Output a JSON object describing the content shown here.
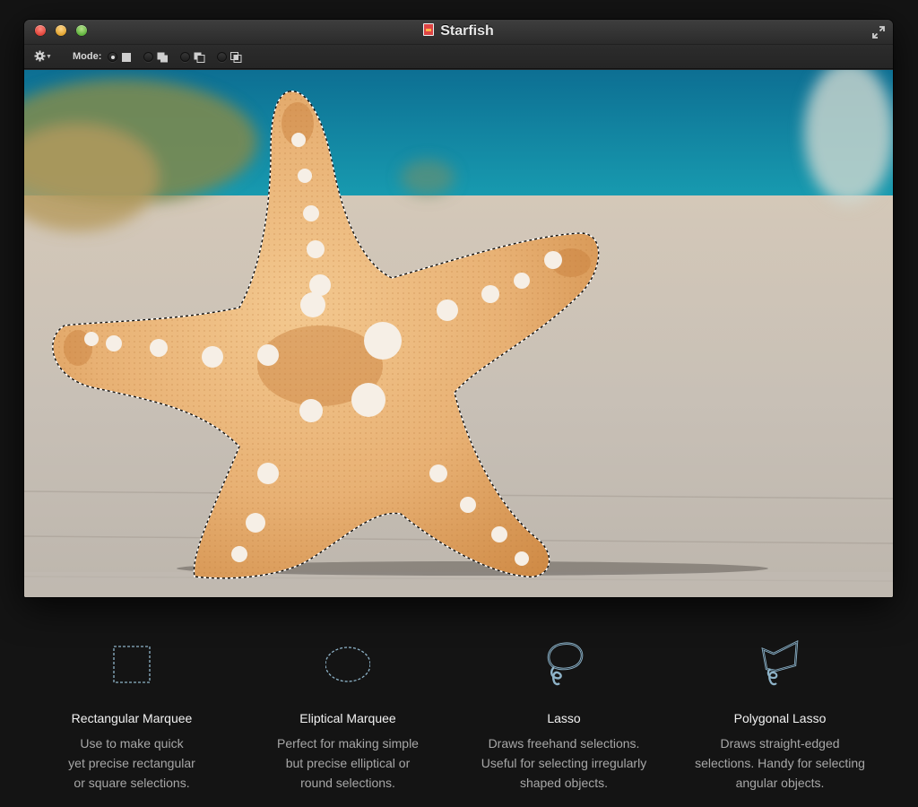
{
  "window": {
    "title": "Starfish"
  },
  "toolbar": {
    "mode_label": "Mode:",
    "modes": [
      {
        "name": "new-selection",
        "selected": true
      },
      {
        "name": "add-to-selection",
        "selected": false
      },
      {
        "name": "subtract-from-selection",
        "selected": false
      },
      {
        "name": "intersect-selection",
        "selected": false
      }
    ]
  },
  "colors": {
    "background": "#141414",
    "sea": "#1a8fa8",
    "sand": "#c9c2ba",
    "starfish": "#e9b77c",
    "icon_stroke": "#8eb3c8"
  },
  "tools": [
    {
      "title": "Rectangular Marquee",
      "icon": "rectangular-marquee-icon",
      "desc": [
        "Use to make quick",
        "yet precise rectangular",
        "or square selections."
      ]
    },
    {
      "title": "Eliptical Marquee",
      "icon": "elliptical-marquee-icon",
      "desc": [
        "Perfect for making simple",
        "but precise elliptical or",
        "round selections."
      ]
    },
    {
      "title": "Lasso",
      "icon": "lasso-icon",
      "desc": [
        "Draws freehand selections.",
        "Useful for selecting irregularly",
        "shaped objects."
      ]
    },
    {
      "title": "Polygonal Lasso",
      "icon": "polygonal-lasso-icon",
      "desc": [
        "Draws straight-edged",
        "selections. Handy for selecting",
        "angular objects."
      ]
    }
  ]
}
